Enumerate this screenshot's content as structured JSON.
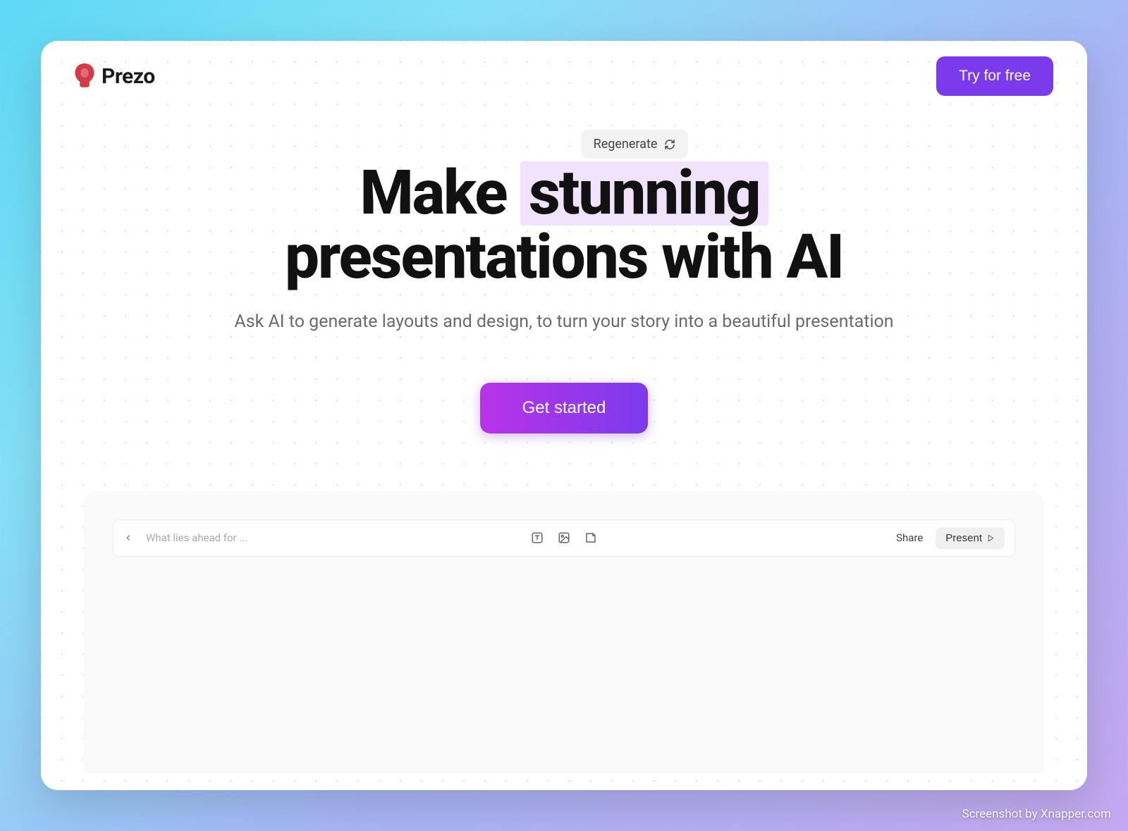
{
  "header": {
    "brand": "Prezo",
    "cta_label": "Try for free"
  },
  "hero": {
    "regenerate_label": "Regenerate",
    "title_prefix": "Make ",
    "title_highlight": "stunning",
    "title_line2": "presentations with AI",
    "subtitle": "Ask AI to generate layouts and design, to turn your story into a beautiful presentation",
    "primary_cta": "Get started"
  },
  "preview": {
    "placeholder": "What lies ahead for ...",
    "share_label": "Share",
    "present_label": "Present"
  },
  "watermark": "Screenshot by Xnapper.com"
}
